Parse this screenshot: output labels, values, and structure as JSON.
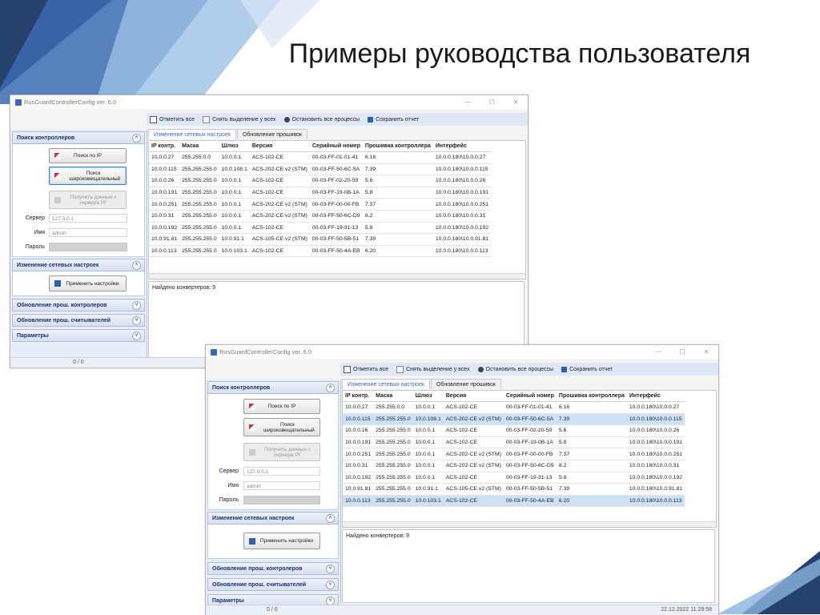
{
  "slide": {
    "title": "Примеры руководства пользователя"
  },
  "colors": {
    "accent_dark": "#27416f",
    "accent_light": "#8bb3df",
    "panel_bg": "#e8eef8",
    "section_text": "#1b2f6e",
    "selected_row": "#cde0f5"
  },
  "windows": [
    {
      "title": "RusGuardControllerConfig ver. 6.0",
      "toolbar": [
        "Отметить все",
        "Снять выделение у всех",
        "Остановить все процессы",
        "Сохранить отчет"
      ],
      "tabs": [
        "Изменение сетевых настроек",
        "Обновление прошивок"
      ],
      "search_section": "Поиск контроллеров",
      "search_ip_btn": "Поиск по IP",
      "broadcast_btn": "Поиск широковещательный",
      "get_data_btn": "Получить данные с сервера РГ",
      "server_label": "Сервер",
      "server_value": "127.0.0.1",
      "name_label": "Имя",
      "name_value": "admin",
      "password_label": "Пароль",
      "net_section": "Изменение сетевых настроек",
      "apply_btn": "Применить настройки",
      "fw_section": "Обновление прош. контролеров",
      "readers_section": "Обновление прош. считывателей",
      "params_section": "Параметры",
      "log": "Найдено конвертеров: 9",
      "status_left": "0 / 0",
      "status_right": ""
    },
    {
      "title": "RusGuardControllerConfig ver. 6.0",
      "toolbar": [
        "Отметить все",
        "Снять выделение у всех",
        "Остановить все процессы",
        "Сохранить отчет"
      ],
      "tabs": [
        "Изменение сетевых настроек",
        "Обновление прошивок"
      ],
      "search_section": "Поиск контроллеров",
      "search_ip_btn": "Поиск по IP",
      "broadcast_btn": "Поиск широковещательный",
      "get_data_btn": "Получить данные с сервера РГ",
      "server_label": "Сервер",
      "server_value": "127.0.0.1",
      "name_label": "Имя",
      "name_value": "admin",
      "password_label": "Пароль",
      "net_section": "Изменение сетевых настроек",
      "apply_btn": "Применить настройки",
      "fw_section": "Обновление прош. контролеров",
      "readers_section": "Обновление прош. считывателей",
      "params_section": "Параметры",
      "log": "Найдено конвертеров: 9",
      "status_left": "0 / 0",
      "status_right": "22.12.2022 11:29:58"
    }
  ],
  "table": {
    "headers": [
      "IP контр.",
      "Маска",
      "Шлюз",
      "Версия",
      "Серийный номер",
      "Прошивка контроллера",
      "Интерфейс"
    ],
    "rows": [
      [
        "10.0.0.27",
        "255.255.0.0",
        "10.0.0.1",
        "ACS-102-CE",
        "00-03-FF-01-01-41",
        "6.16",
        "10.0.0.180\\10.0.0.27"
      ],
      [
        "10.0.0.115",
        "255.255.255.0",
        "10.0.108.1",
        "ACS-202-CE v2 (STM)",
        "00-03-FF-50-6C-5A",
        "7.39",
        "10.0.0.180\\10.0.0.115"
      ],
      [
        "10.0.0.26",
        "255.255.255.0",
        "10.0.0.1",
        "ACS-102-CE",
        "00-03-FF-02-20-59",
        "5.6",
        "10.0.0.180\\10.0.0.26"
      ],
      [
        "10.0.0.191",
        "255.255.255.0",
        "10.0.0.1",
        "ACS-102-CE",
        "00-03-FF-19-0B-1A",
        "5.8",
        "10.0.0.180\\10.0.0.191"
      ],
      [
        "10.0.0.251",
        "255.255.255.0",
        "10.0.0.1",
        "ACS-202-CE v2 (STM)",
        "00-03-FF-00-00-FB",
        "7.37",
        "10.0.0.180\\10.0.0.251"
      ],
      [
        "10.0.0.31",
        "255.255.255.0",
        "10.0.0.1",
        "ACS-202-CE v2 (STM)",
        "00-03-FF-50-6C-D9",
        "8.2",
        "10.0.0.180\\10.0.0.31"
      ],
      [
        "10.0.0.192",
        "255.255.255.0",
        "10.0.0.1",
        "ACS-102-CE",
        "00-03-FF-19-31-13",
        "5.8",
        "10.0.0.180\\10.0.0.192"
      ],
      [
        "10.0.91.81",
        "255.255.255.0",
        "10.0.91.1",
        "ACS-105-CE v2 (STM)",
        "00-03-FF-50-5B-51",
        "7.39",
        "10.0.0.180\\10.0.91.81"
      ],
      [
        "10.0.0.113",
        "255.255.255.0",
        "10.0.103.1",
        "ACS-102-CE",
        "00-03-FF-50-4A-EB",
        "6.20",
        "10.0.0.180\\10.0.0.113"
      ]
    ],
    "selected_rows_window2": [
      1,
      8
    ]
  }
}
